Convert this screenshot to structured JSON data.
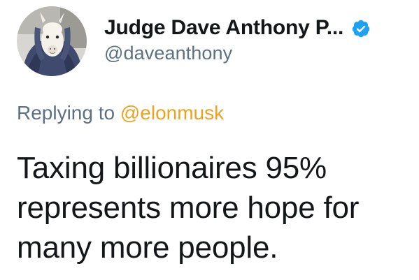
{
  "author": {
    "display_name": "Judge Dave Anthony P...",
    "handle": "@daveanthony",
    "verified": true,
    "avatar_icon": "llama-in-hoodie-avatar"
  },
  "reply": {
    "prefix": "Replying to",
    "mention": "@elonmusk"
  },
  "tweet": {
    "lines": [
      "Taxing billionaires 95%",
      "represents more hope for",
      "many more people."
    ]
  },
  "colors": {
    "text": "#14171a",
    "secondary": "#5b7083",
    "mention": "#f0a11e",
    "verified": "#1da1f2"
  }
}
